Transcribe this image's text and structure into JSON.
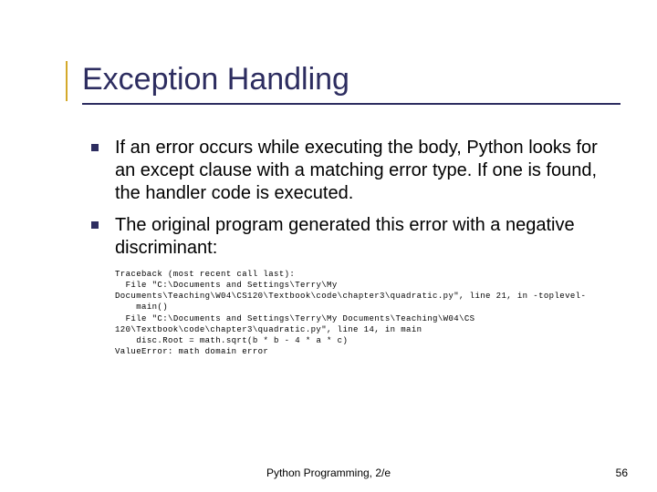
{
  "title": "Exception Handling",
  "bullets": [
    "If an error occurs while executing the body, Python looks for an except clause with a matching error type. If one is found, the handler code is executed.",
    "The original program generated this error with a negative discriminant:"
  ],
  "traceback": "Traceback (most recent call last):\n  File \"C:\\Documents and Settings\\Terry\\My Documents\\Teaching\\W04\\CS120\\Textbook\\code\\chapter3\\quadratic.py\", line 21, in -toplevel-\n    main()\n  File \"C:\\Documents and Settings\\Terry\\My Documents\\Teaching\\W04\\CS 120\\Textbook\\code\\chapter3\\quadratic.py\", line 14, in main\n    disc.Root = math.sqrt(b * b - 4 * a * c)\nValueError: math domain error",
  "footer": {
    "center": "Python Programming, 2/e",
    "page": "56"
  }
}
